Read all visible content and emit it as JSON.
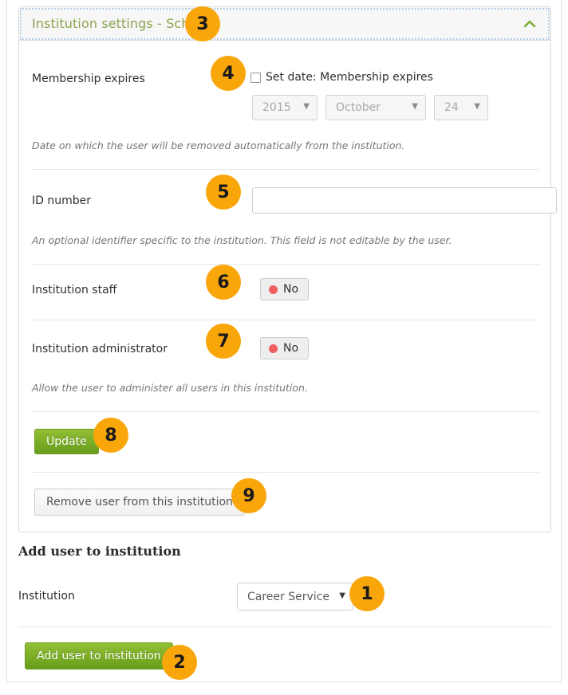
{
  "panel": {
    "title": "Institution settings - School",
    "collapse_icon": "chevron-up-icon",
    "membership": {
      "label": "Membership expires",
      "checkbox_label": "Set date: Membership expires",
      "checked": false,
      "year": "2015",
      "month": "October",
      "day": "24",
      "help": "Date on which the user will be removed automatically from the institution."
    },
    "id_number": {
      "label": "ID number",
      "value": "",
      "placeholder": "",
      "help": "An optional identifier specific to the institution. This field is not editable by the user."
    },
    "staff": {
      "label": "Institution staff",
      "toggle_value": "No"
    },
    "administrator": {
      "label": "Institution administrator",
      "toggle_value": "No",
      "help": "Allow the user to administer all users in this institution."
    },
    "update_label": "Update",
    "remove_label": "Remove user from this institution"
  },
  "add_user": {
    "heading": "Add user to institution",
    "institution_label": "Institution",
    "institution_value": "Career Service",
    "submit_label": "Add user to institution"
  },
  "badges": {
    "b1": "1",
    "b2": "2",
    "b3": "3",
    "b4": "4",
    "b5": "5",
    "b6": "6",
    "b7": "7",
    "b8": "8",
    "b9": "9"
  },
  "colors": {
    "badge": "#f9a60b",
    "panel_title": "#8ba44f",
    "primary_button": "#7cae27",
    "status_dot": "#ef5f5f"
  }
}
